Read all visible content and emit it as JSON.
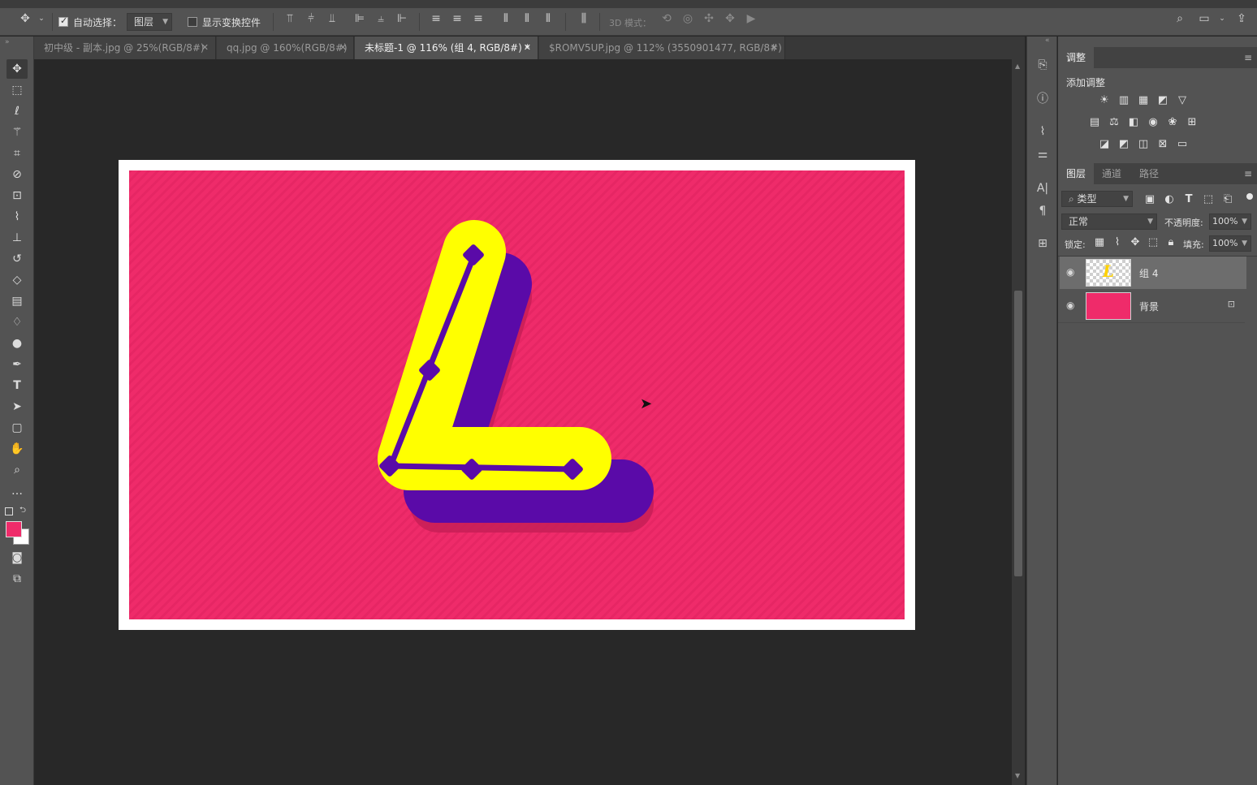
{
  "options_bar": {
    "auto_select_label": "自动选择：",
    "auto_select_checked": true,
    "auto_select_target": "图层",
    "show_transform_label": "显示变换控件",
    "show_transform_checked": false,
    "mode_3d_label": "3D 模式："
  },
  "tabs": [
    {
      "label": "初中级 - 副本.jpg @ 25%(RGB/8#)",
      "active": false
    },
    {
      "label": "qq.jpg @ 160%(RGB/8#)",
      "active": false
    },
    {
      "label": "未标题-1 @ 116% (组 4, RGB/8#) *",
      "active": true
    },
    {
      "label": "$ROMV5UP.jpg @ 112% (3550901477, RGB/8#) *",
      "active": false
    }
  ],
  "adjustments_panel": {
    "tab_label": "调整",
    "add_adjustment_label": "添加调整"
  },
  "layers_panel": {
    "tabs": [
      "图层",
      "通道",
      "路径"
    ],
    "filter_kind": "类型",
    "blend_mode": "正常",
    "opacity_label": "不透明度:",
    "opacity_value": "100%",
    "lock_label": "锁定:",
    "fill_label": "填充:",
    "fill_value": "100%",
    "layers": [
      {
        "name": "组 4",
        "selected": true,
        "locked": false
      },
      {
        "name": "背景",
        "selected": false,
        "locked": true
      }
    ]
  },
  "colors": {
    "foreground": "#ef2b6a",
    "background": "#ffffff",
    "canvas_pink": "#ef2b6a",
    "letter_yellow": "#ffff00",
    "letter_purple": "#5a0aa8"
  }
}
